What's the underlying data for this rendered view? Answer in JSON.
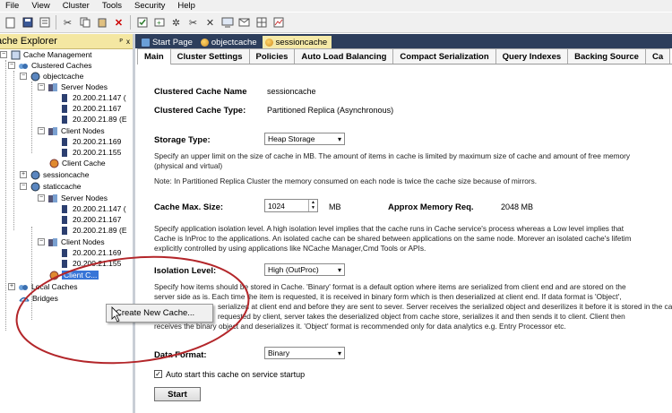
{
  "menubar": [
    "File",
    "View",
    "Cluster",
    "Tools",
    "Security",
    "Help"
  ],
  "explorer": {
    "title": "ache Explorer",
    "pin": "ᴾ",
    "close": "x",
    "tree": {
      "root": "Cache Management",
      "clustered": "Clustered Caches",
      "objectcache": "objectcache",
      "server_nodes": "Server Nodes",
      "client_nodes": "Client Nodes",
      "client_cache": "Client Cache",
      "sessioncache": "sessioncache",
      "staticcache": "staticcache",
      "client_cache_selected": "Client C...",
      "local_caches": "Local Caches",
      "bridges": "Bridges",
      "ips": [
        "20.200.21.147 (",
        "20.200.21.167",
        "20.200.21.89 (E",
        "20.200.21.169",
        "20.200.21.155"
      ]
    }
  },
  "context_menu": {
    "create_new_cache": "Create New Cache..."
  },
  "doc_tabs": [
    "Start Page",
    "objectcache",
    "sessioncache"
  ],
  "sub_tabs": [
    "Main",
    "Cluster Settings",
    "Policies",
    "Auto Load Balancing",
    "Compact Serialization",
    "Query Indexes",
    "Backing Source",
    "Ca"
  ],
  "main": {
    "clustered_cache_name_label": "Clustered Cache Name",
    "clustered_cache_name_value": "sessioncache",
    "clustered_cache_type_label": "Clustered Cache Type:",
    "clustered_cache_type_value": "Partitioned Replica (Asynchronous)",
    "storage_type_label": "Storage Type:",
    "storage_type_value": "Heap Storage",
    "storage_desc_1": "Specify an upper limit on the size of cache in MB. The amount of items in cache is limited by maximum size of cache and amount of free memory",
    "storage_desc_2": "(physical and virtual)",
    "storage_note": "Note: In Partitioned Replica Cluster the memory consumed on each node is twice the cache size because of mirrors.",
    "cache_max_size_label": "Cache Max. Size:",
    "cache_max_size_value": "1024",
    "cache_max_size_unit": "MB",
    "approx_memory_label": "Approx Memory Req.",
    "approx_memory_value": "2048 MB",
    "isolation_desc_1": "Specify application isolation level. A high isolation level implies that the cache runs  in Cache service's process whereas a Low level implies that",
    "isolation_desc_2": "Cache is InProc to the applications. An isolated cache can be shared between applications on the same node. Morever an isolated cache's lifetim",
    "isolation_desc_3": "explicitly controlled by using applications like NCache Manager,Cmd Tools or APIs.",
    "isolation_level_label": "Isolation Level:",
    "isolation_level_value": "High (OutProc)",
    "format_desc_1": "Specify how items should be stored in Cache. 'Binary' format is a default option where items are serialized from client end and are stored on the",
    "format_desc_2": "server side as is. Each time the item is requested, it is received in binary form which is then deserialized at client end. If data format is 'Object',",
    "format_desc_3": "serialized at client end and before they are sent to sever. Server receives the serialized object and deserilizes it before it is stored in the ca",
    "format_desc_4": "requested by client, server takes the deserialized object from cache store, serializes it and then sends it to client. Client then",
    "format_desc_5": "receives the binary object and deserializes it. 'Object' format is recommended only for data analytics e.g.  Entry Processor etc.",
    "data_format_label": "Data Format:",
    "data_format_value": "Binary",
    "auto_start_label": "Auto start this cache on service startup",
    "start_button": "Start"
  }
}
